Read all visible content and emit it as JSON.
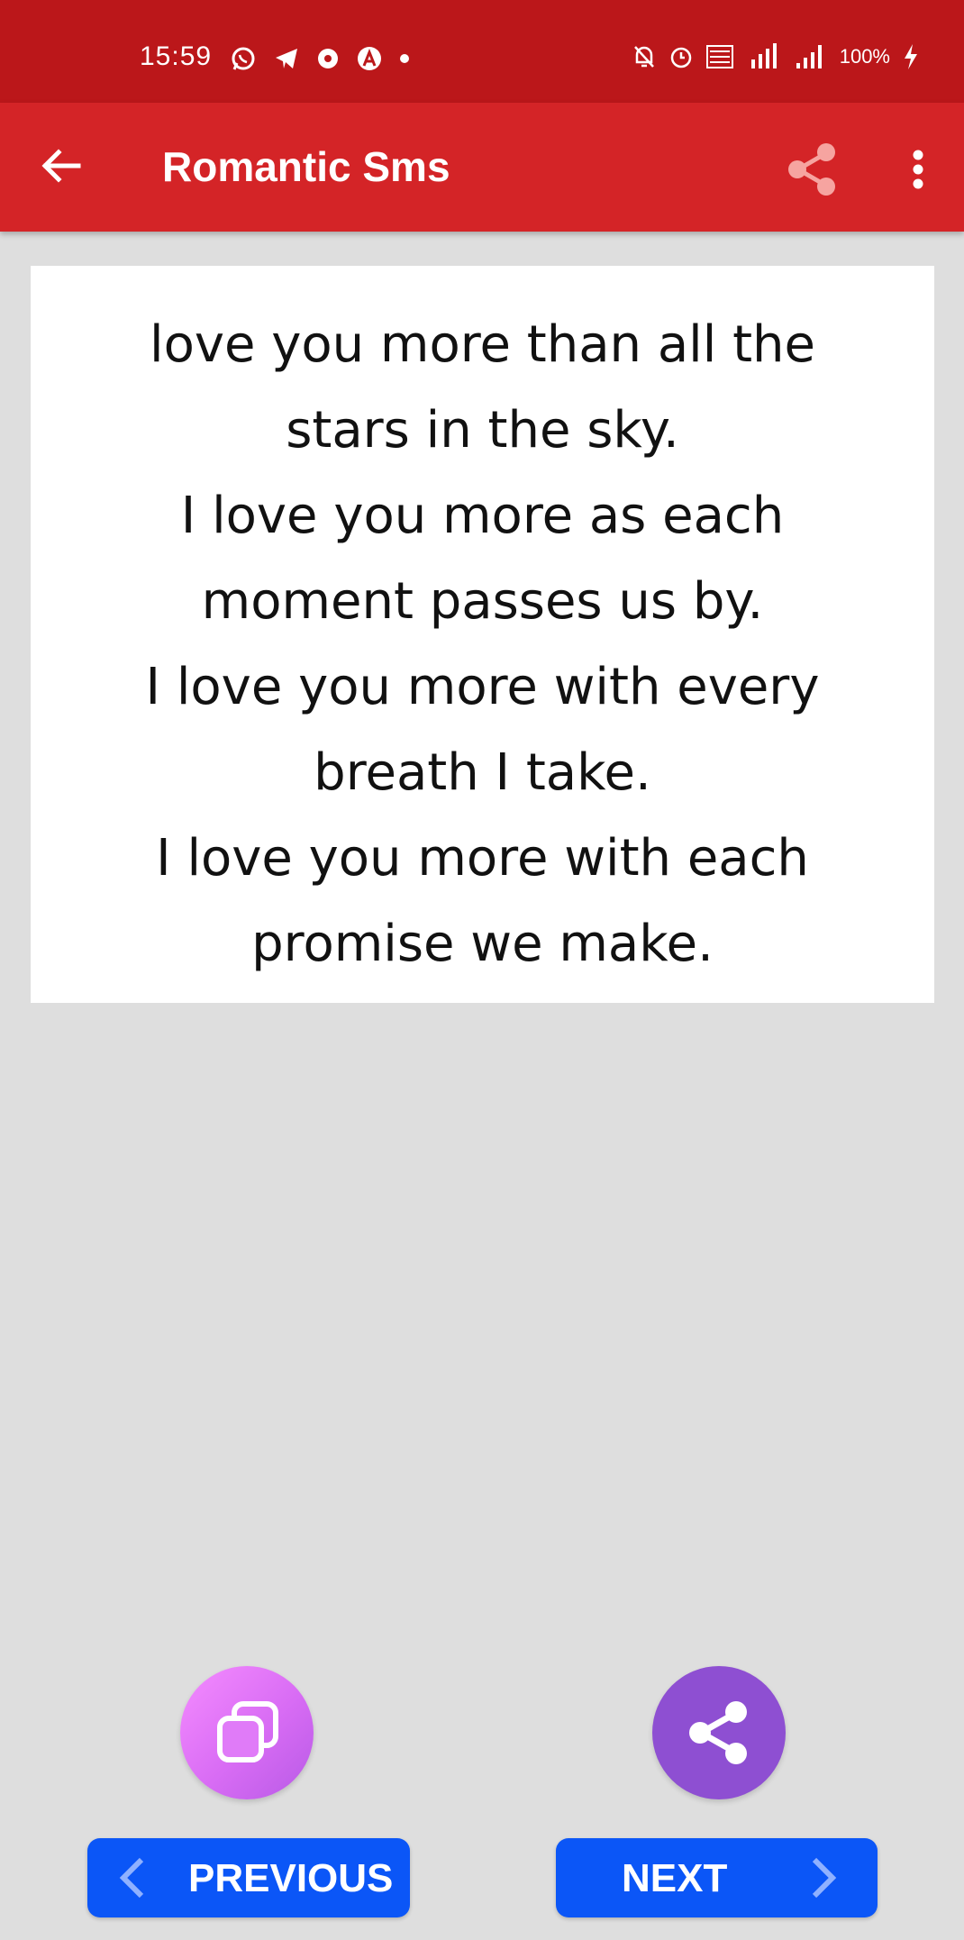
{
  "status_bar": {
    "time": "15:59",
    "battery": "100%",
    "left_icons": [
      "whatsapp-icon",
      "telegram-icon",
      "chrome-icon",
      "arc-icon",
      "dot-icon"
    ],
    "right_icons": [
      "mute-icon",
      "alarm-icon",
      "volte-icon",
      "signal-4g-icon",
      "signal-icon",
      "charging-icon"
    ]
  },
  "app_bar": {
    "title": "Romantic Sms",
    "back_icon": "back-arrow-icon",
    "share_icon": "share-icon",
    "more_icon": "more-vert-icon"
  },
  "message": {
    "lines": [
      "love you more than all the",
      "stars in the sky.",
      "I love you more as each",
      "moment passes us by.",
      "I love you more with every",
      "breath I take.",
      "I love you more with each",
      "promise we make."
    ]
  },
  "actions": {
    "copy_icon": "copy-icon",
    "share_icon": "share-icon"
  },
  "navigation": {
    "previous_label": "PREVIOUS",
    "next_label": "NEXT"
  },
  "colors": {
    "status_bar": "#bb171a",
    "app_bar": "#d42427",
    "background": "#dedede",
    "nav_button": "#0b56f7",
    "share_fab": "#8e4fd2",
    "copy_fab": "#e27cfb"
  }
}
